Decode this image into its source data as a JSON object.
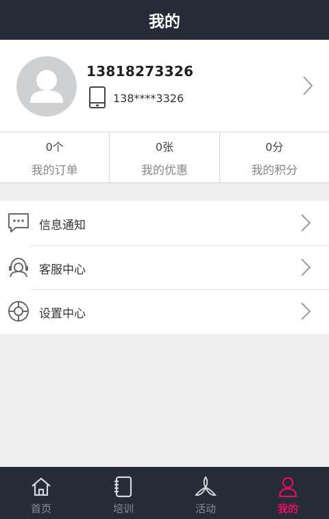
{
  "header": {
    "title": "我的"
  },
  "profile": {
    "username": "13818273326",
    "phone_masked": "138****3326"
  },
  "stats": [
    {
      "value": "0个",
      "label": "我的订单"
    },
    {
      "value": "0张",
      "label": "我的优惠"
    },
    {
      "value": "0分",
      "label": "我的积分"
    }
  ],
  "menu": [
    {
      "label": "信息通知",
      "icon": "message-icon"
    },
    {
      "label": "客服中心",
      "icon": "customer-service-icon"
    },
    {
      "label": "设置中心",
      "icon": "settings-icon"
    }
  ],
  "tabs": [
    {
      "label": "首页",
      "icon": "home-icon",
      "active": false
    },
    {
      "label": "培训",
      "icon": "notebook-icon",
      "active": false
    },
    {
      "label": "活动",
      "icon": "fan-icon",
      "active": false
    },
    {
      "label": "我的",
      "icon": "person-icon",
      "active": true
    }
  ],
  "colors": {
    "header_bg": "#272b37",
    "tabbar_bg": "#272b37",
    "accent": "#e0115f",
    "page_bg": "#efefef"
  }
}
